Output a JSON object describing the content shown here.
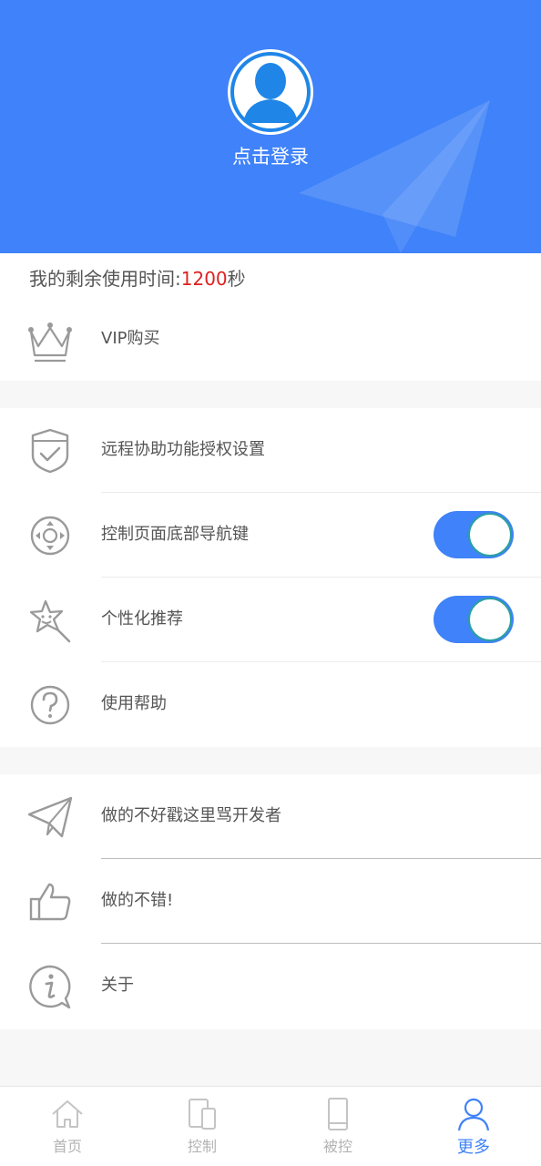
{
  "header": {
    "login_label": "点击登录"
  },
  "remaining_time": {
    "prefix": "我的剩余使用时间:",
    "value": "1200",
    "unit": "秒"
  },
  "menu": {
    "vip": {
      "label": "VIP购买",
      "icon": "crown-icon"
    },
    "remote_auth": {
      "label": "远程协助功能授权设置",
      "icon": "shield-check-icon"
    },
    "nav_keys": {
      "label": "控制页面底部导航键",
      "icon": "dpad-icon",
      "enabled": true
    },
    "personalized": {
      "label": "个性化推荐",
      "icon": "star-wand-icon",
      "enabled": true
    },
    "help": {
      "label": "使用帮助",
      "icon": "question-icon"
    },
    "feedback_bad": {
      "label": "做的不好戳这里骂开发者",
      "icon": "paper-plane-icon"
    },
    "feedback_good": {
      "label": "做的不错!",
      "icon": "thumbs-up-icon"
    },
    "about": {
      "label": "关于",
      "icon": "info-icon"
    }
  },
  "tabbar": {
    "tabs": [
      {
        "label": "首页",
        "icon": "home-icon",
        "active": false
      },
      {
        "label": "控制",
        "icon": "devices-icon",
        "active": false
      },
      {
        "label": "被控",
        "icon": "phone-icon",
        "active": false
      },
      {
        "label": "更多",
        "icon": "person-icon",
        "active": true
      }
    ]
  },
  "colors": {
    "accent": "#3f82f9",
    "highlight": "#e02020",
    "text": "#555555",
    "inactive": "#b3b3b3"
  }
}
